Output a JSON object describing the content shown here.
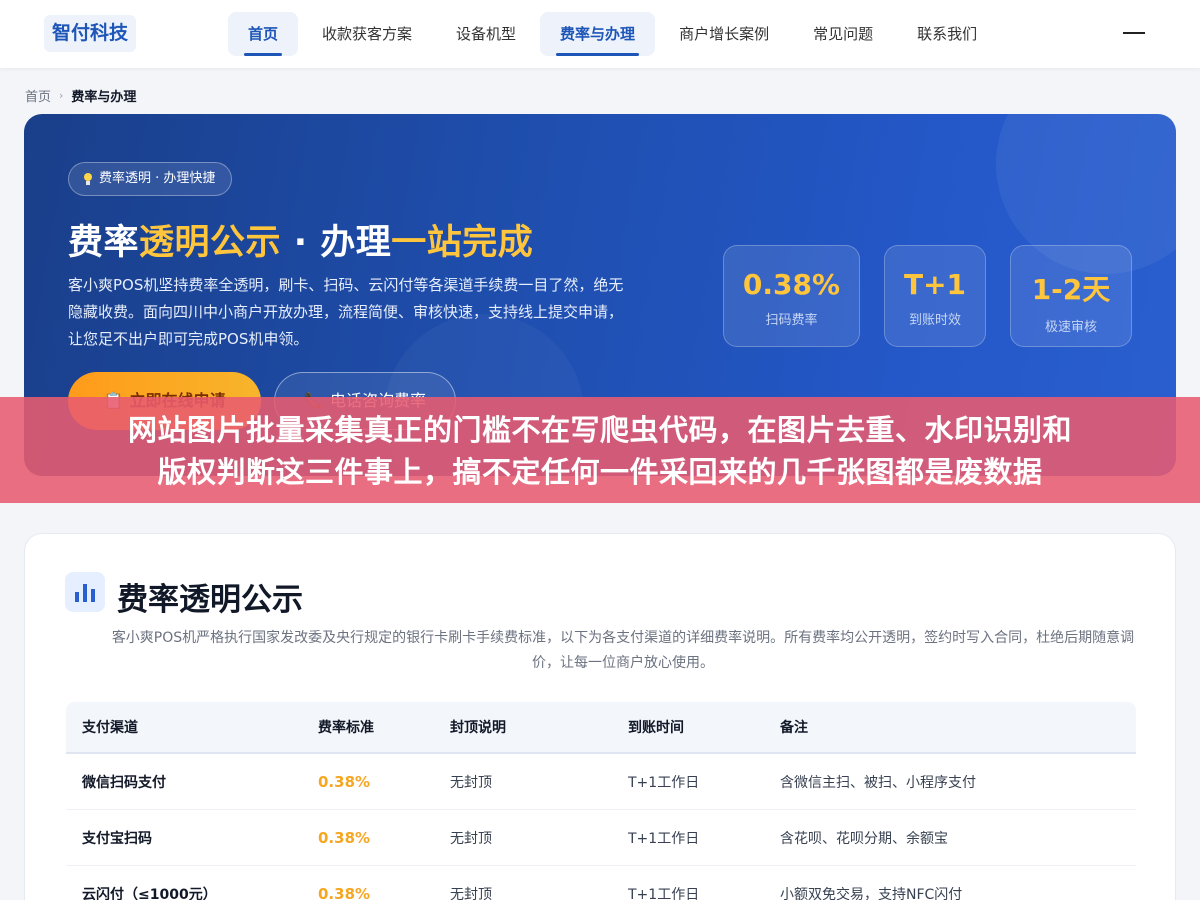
{
  "header": {
    "logo": "智付科技",
    "nav": [
      "首页",
      "收款获客方案",
      "设备机型",
      "费率与办理",
      "商户增长案例",
      "常见问题",
      "联系我们"
    ]
  },
  "breadcrumb": {
    "home": "首页",
    "separator": "›",
    "current": "费率与办理"
  },
  "hero": {
    "tag": "费率透明 · 办理快捷",
    "title_parts": [
      "费率",
      "透明公示",
      " · 办理",
      "一站完成"
    ],
    "description": "客小爽POS机坚持费率全透明，刷卡、扫码、云闪付等各渠道手续费一目了然，绝无隐藏收费。面向四川中小商户开放办理，流程简便、审核快速，支持线上提交申请，让您足不出户即可完成POS机申领。",
    "apply_button": "立即在线申请",
    "call_button": "电话咨询费率",
    "stats": [
      {
        "value": "0.38%",
        "label": "扫码费率"
      },
      {
        "value": "T+1",
        "label": "到账时效"
      },
      {
        "value": "1-2天",
        "label": "极速审核"
      }
    ]
  },
  "banner": {
    "line1": "网站图片批量采集真正的门槛不在写爬虫代码，在图片去重、水印识别和",
    "line2": "版权判断这三件事上，搞不定任何一件采回来的几千张图都是废数据"
  },
  "section": {
    "title": "费率透明公示",
    "description": "客小爽POS机严格执行国家发改委及央行规定的银行卡刷卡手续费标准，以下为各支付渠道的详细费率说明。所有费率均公开透明，签约时写入合同，杜绝后期随意调价，让每一位商户放心使用。"
  },
  "table": {
    "headers": [
      "支付渠道",
      "费率标准",
      "封顶说明",
      "到账时间",
      "备注"
    ],
    "rows": [
      [
        "微信扫码支付",
        "0.38%",
        "无封顶",
        "T+1工作日",
        "含微信主扫、被扫、小程序支付"
      ],
      [
        "支付宝扫码",
        "0.38%",
        "无封顶",
        "T+1工作日",
        "含花呗、花呗分期、余额宝"
      ],
      [
        "云闪付（≤1000元）",
        "0.38%",
        "无封顶",
        "T+1工作日",
        "小额双免交易，支持NFC闪付"
      ]
    ]
  },
  "colors": {
    "primary": "#1e56b8",
    "accent": "#ffc53d",
    "rate": "#f5a623",
    "banner": "#e85b70"
  }
}
